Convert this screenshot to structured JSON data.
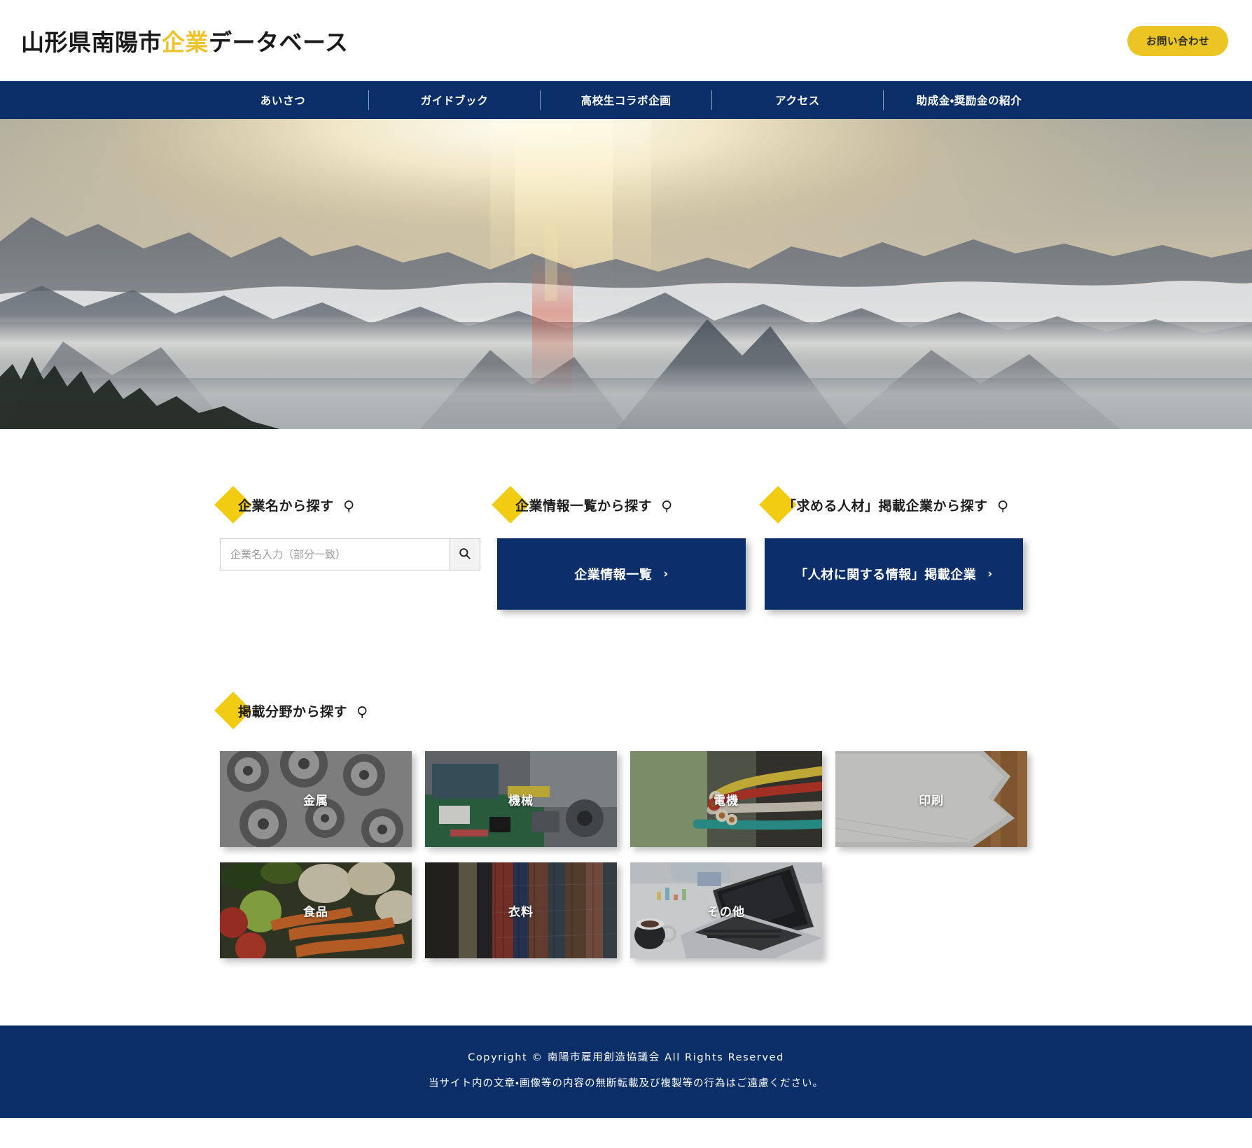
{
  "header": {
    "logo_prefix": "山形県南陽市",
    "logo_accent": "企業",
    "logo_suffix": "データベース",
    "contact_label": "お問い合わせ",
    "accent_color": "#edc22a",
    "navy_color": "#0a2f68"
  },
  "nav": {
    "items": [
      {
        "label": "あいさつ"
      },
      {
        "label": "ガイドブック"
      },
      {
        "label": "高校生コラボ企画"
      },
      {
        "label": "アクセス"
      },
      {
        "label": "助成金・奨励金の紹介"
      }
    ]
  },
  "hero": {
    "image_alt": "雲海に浮かぶ山並みと朝日"
  },
  "search": {
    "by_name": {
      "heading": "企業名から探す",
      "placeholder": "企業名入力（部分一致）",
      "value": ""
    },
    "by_list": {
      "heading": "企業情報一覧から探す",
      "button_label": "企業情報一覧",
      "chevron": "›"
    },
    "by_talent": {
      "heading": "「求める人材」掲載企業から探す",
      "button_label": "「人材に関する情報」掲載企業",
      "chevron": "›"
    }
  },
  "categories": {
    "heading": "掲載分野から探す",
    "items": [
      {
        "label": "金属",
        "image": "gears-photo"
      },
      {
        "label": "機械",
        "image": "circuit-board-photo"
      },
      {
        "label": "電機",
        "image": "electrical-wires-photo"
      },
      {
        "label": "印刷",
        "image": "paper-stack-photo"
      },
      {
        "label": "食品",
        "image": "vegetables-photo"
      },
      {
        "label": "衣料",
        "image": "clothing-rack-photo"
      },
      {
        "label": "その他",
        "image": "laptop-desk-photo"
      }
    ]
  },
  "footer": {
    "copyright": "Copyright © 南陽市雇用創造協議会 All Rights Reserved",
    "notice": "当サイト内の文章・画像等の内容の無断転載及び複製等の行為はご遠慮ください。"
  }
}
